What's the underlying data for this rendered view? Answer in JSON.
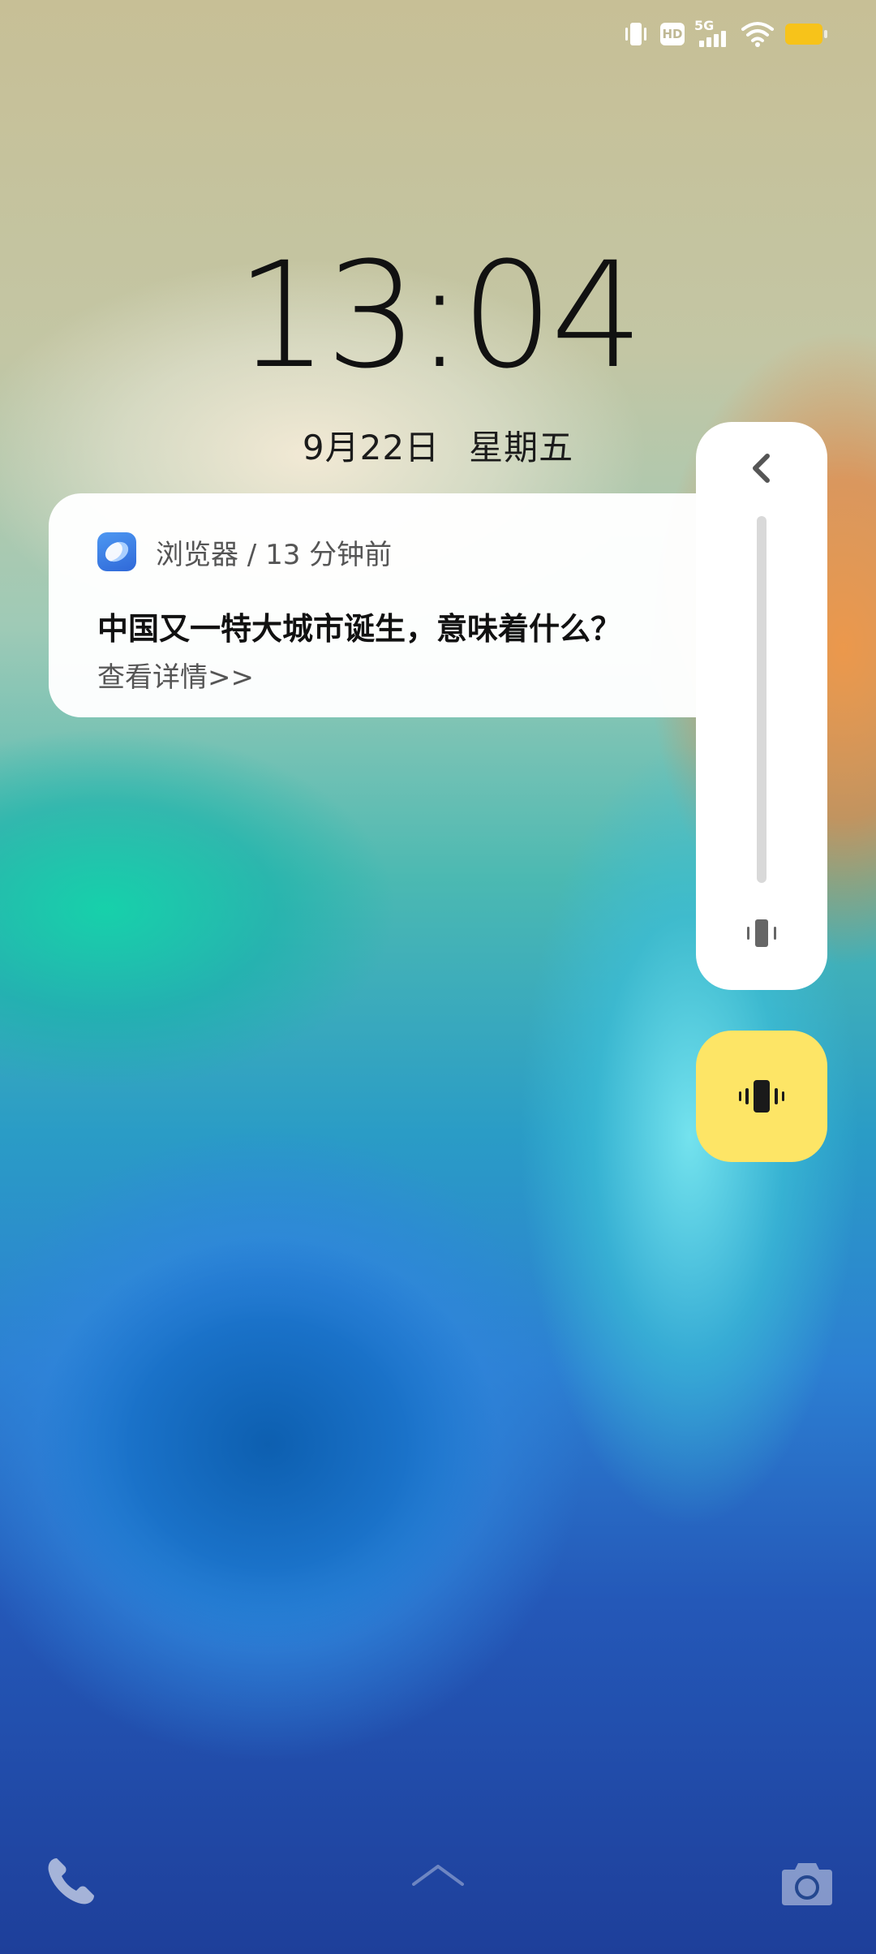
{
  "status_bar": {
    "icons": [
      "vibrate-icon",
      "hd-icon",
      "signal-5g-icon",
      "wifi-icon",
      "battery-icon"
    ],
    "hd_label": "HD",
    "network_label": "5G",
    "battery_color": "#f7c31a"
  },
  "lockscreen": {
    "time": "13:04",
    "date": "9月22日",
    "weekday": "星期五"
  },
  "notification": {
    "app_icon": "browser-icon",
    "meta": "浏览器 / 13 分钟前",
    "title": "中国又一特大城市诞生，意味着什么？",
    "link_text": "查看详情>>"
  },
  "volume_panel": {
    "back_icon": "chevron-left-icon",
    "mode_icon": "vibrate-icon",
    "level": 0,
    "toggle_icon": "vibrate-icon",
    "toggle_color": "#fde566"
  },
  "bottom": {
    "left_shortcut": "phone-icon",
    "right_shortcut": "camera-icon"
  }
}
